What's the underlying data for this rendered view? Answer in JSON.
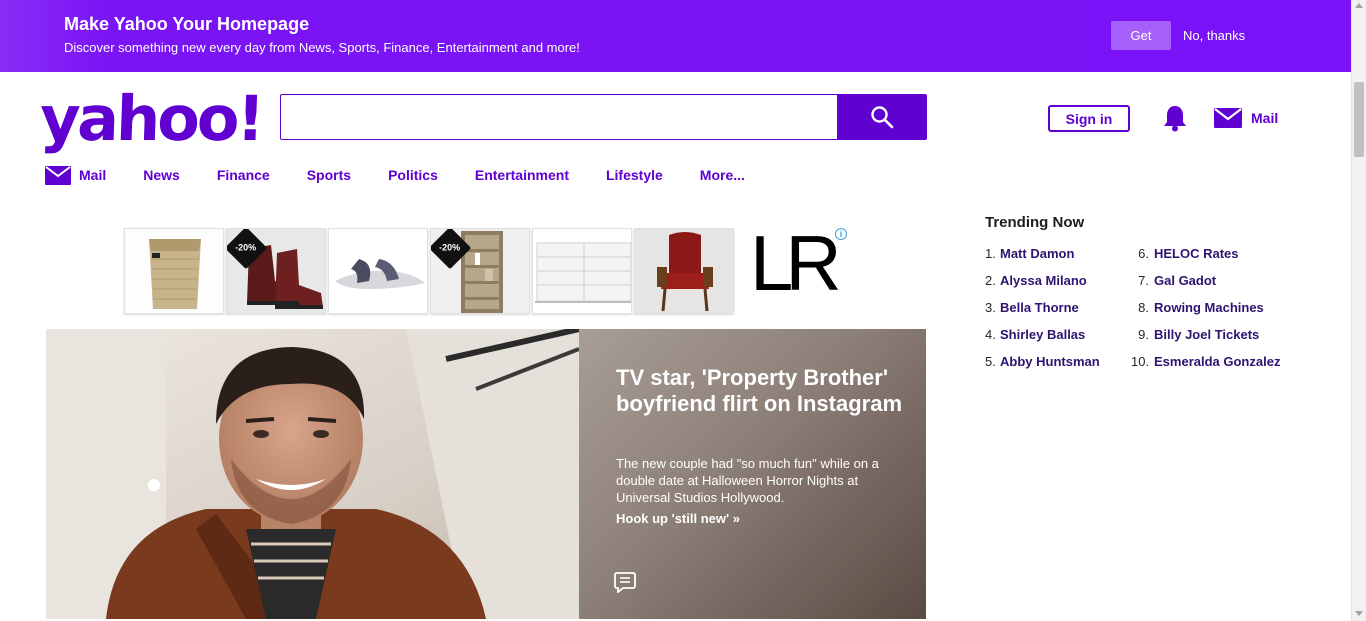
{
  "banner": {
    "title": "Make Yahoo Your Homepage",
    "subtitle": "Discover something new every day from News, Sports, Finance, Entertainment and more!",
    "get_label": "Get",
    "no_thanks_label": "No, thanks"
  },
  "header": {
    "logo_text": "yahoo!",
    "search_placeholder": "",
    "signin_label": "Sign in",
    "mail_label": "Mail"
  },
  "nav": {
    "items": [
      {
        "label": "Mail"
      },
      {
        "label": "News"
      },
      {
        "label": "Finance"
      },
      {
        "label": "Sports"
      },
      {
        "label": "Politics"
      },
      {
        "label": "Entertainment"
      },
      {
        "label": "Lifestyle"
      },
      {
        "label": "More..."
      }
    ]
  },
  "ad": {
    "badge_text": "-20%",
    "brand_text": "LR",
    "info_icon": "i"
  },
  "hero": {
    "title": "TV star, 'Property Brother' boyfriend flirt on Instagram",
    "description": "The new couple had \"so much fun\" while on a double date at Halloween Horror Nights at Universal Studios Hollywood.",
    "link_text": "Hook up 'still new' »"
  },
  "trending": {
    "title": "Trending Now",
    "items": [
      {
        "num": "1.",
        "name": "Matt Damon"
      },
      {
        "num": "2.",
        "name": "Alyssa Milano"
      },
      {
        "num": "3.",
        "name": "Bella Thorne"
      },
      {
        "num": "4.",
        "name": "Shirley Ballas"
      },
      {
        "num": "5.",
        "name": "Abby Huntsman"
      },
      {
        "num": "6.",
        "name": "HELOC Rates"
      },
      {
        "num": "7.",
        "name": "Gal Gadot"
      },
      {
        "num": "8.",
        "name": "Rowing Machines"
      },
      {
        "num": "9.",
        "name": "Billy Joel Tickets"
      },
      {
        "num": "10.",
        "name": "Esmeralda Gonzalez"
      }
    ]
  },
  "colors": {
    "brand_purple": "#6001d2",
    "banner_purple": "#7a12f7"
  }
}
